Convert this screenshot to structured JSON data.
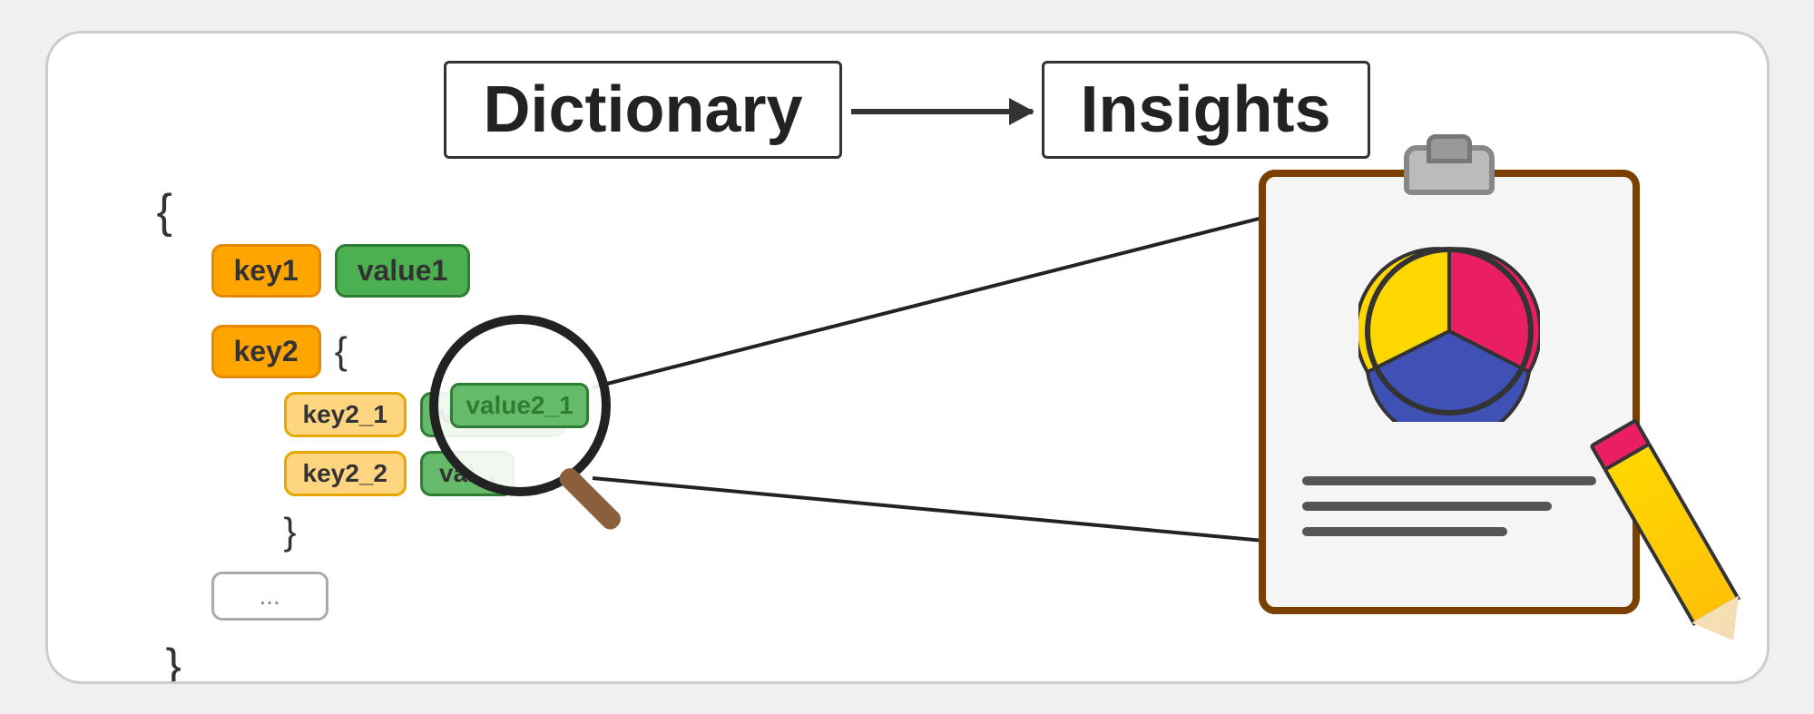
{
  "header": {
    "dictionary_label": "Dictionary",
    "insights_label": "Insights"
  },
  "dict": {
    "brace_open": "{",
    "row1": {
      "key": "key1",
      "value": "value1"
    },
    "row2": {
      "key": "key2",
      "brace": "{",
      "nested": [
        {
          "key": "key2_1",
          "value": "value2_1"
        },
        {
          "key": "key2_2",
          "value": "val..."
        }
      ],
      "brace_close": "}"
    },
    "ellipsis": "...",
    "brace_close": "}"
  },
  "magnifier": {
    "zoom_value": "value2_1"
  },
  "pie_chart": {
    "segments": [
      {
        "color": "#E91E63",
        "start": 0,
        "end": 120
      },
      {
        "color": "#3F51B5",
        "start": 120,
        "end": 270
      },
      {
        "color": "#FFD700",
        "start": 270,
        "end": 360
      }
    ]
  },
  "colors": {
    "key_bg": "#FFA500",
    "key_border": "#e68900",
    "value_bg": "#4CAF50",
    "value_border": "#2e7d32",
    "clipboard_border": "#7B3F00",
    "pencil_body": "#FFD700",
    "pencil_eraser": "#E91E63"
  }
}
